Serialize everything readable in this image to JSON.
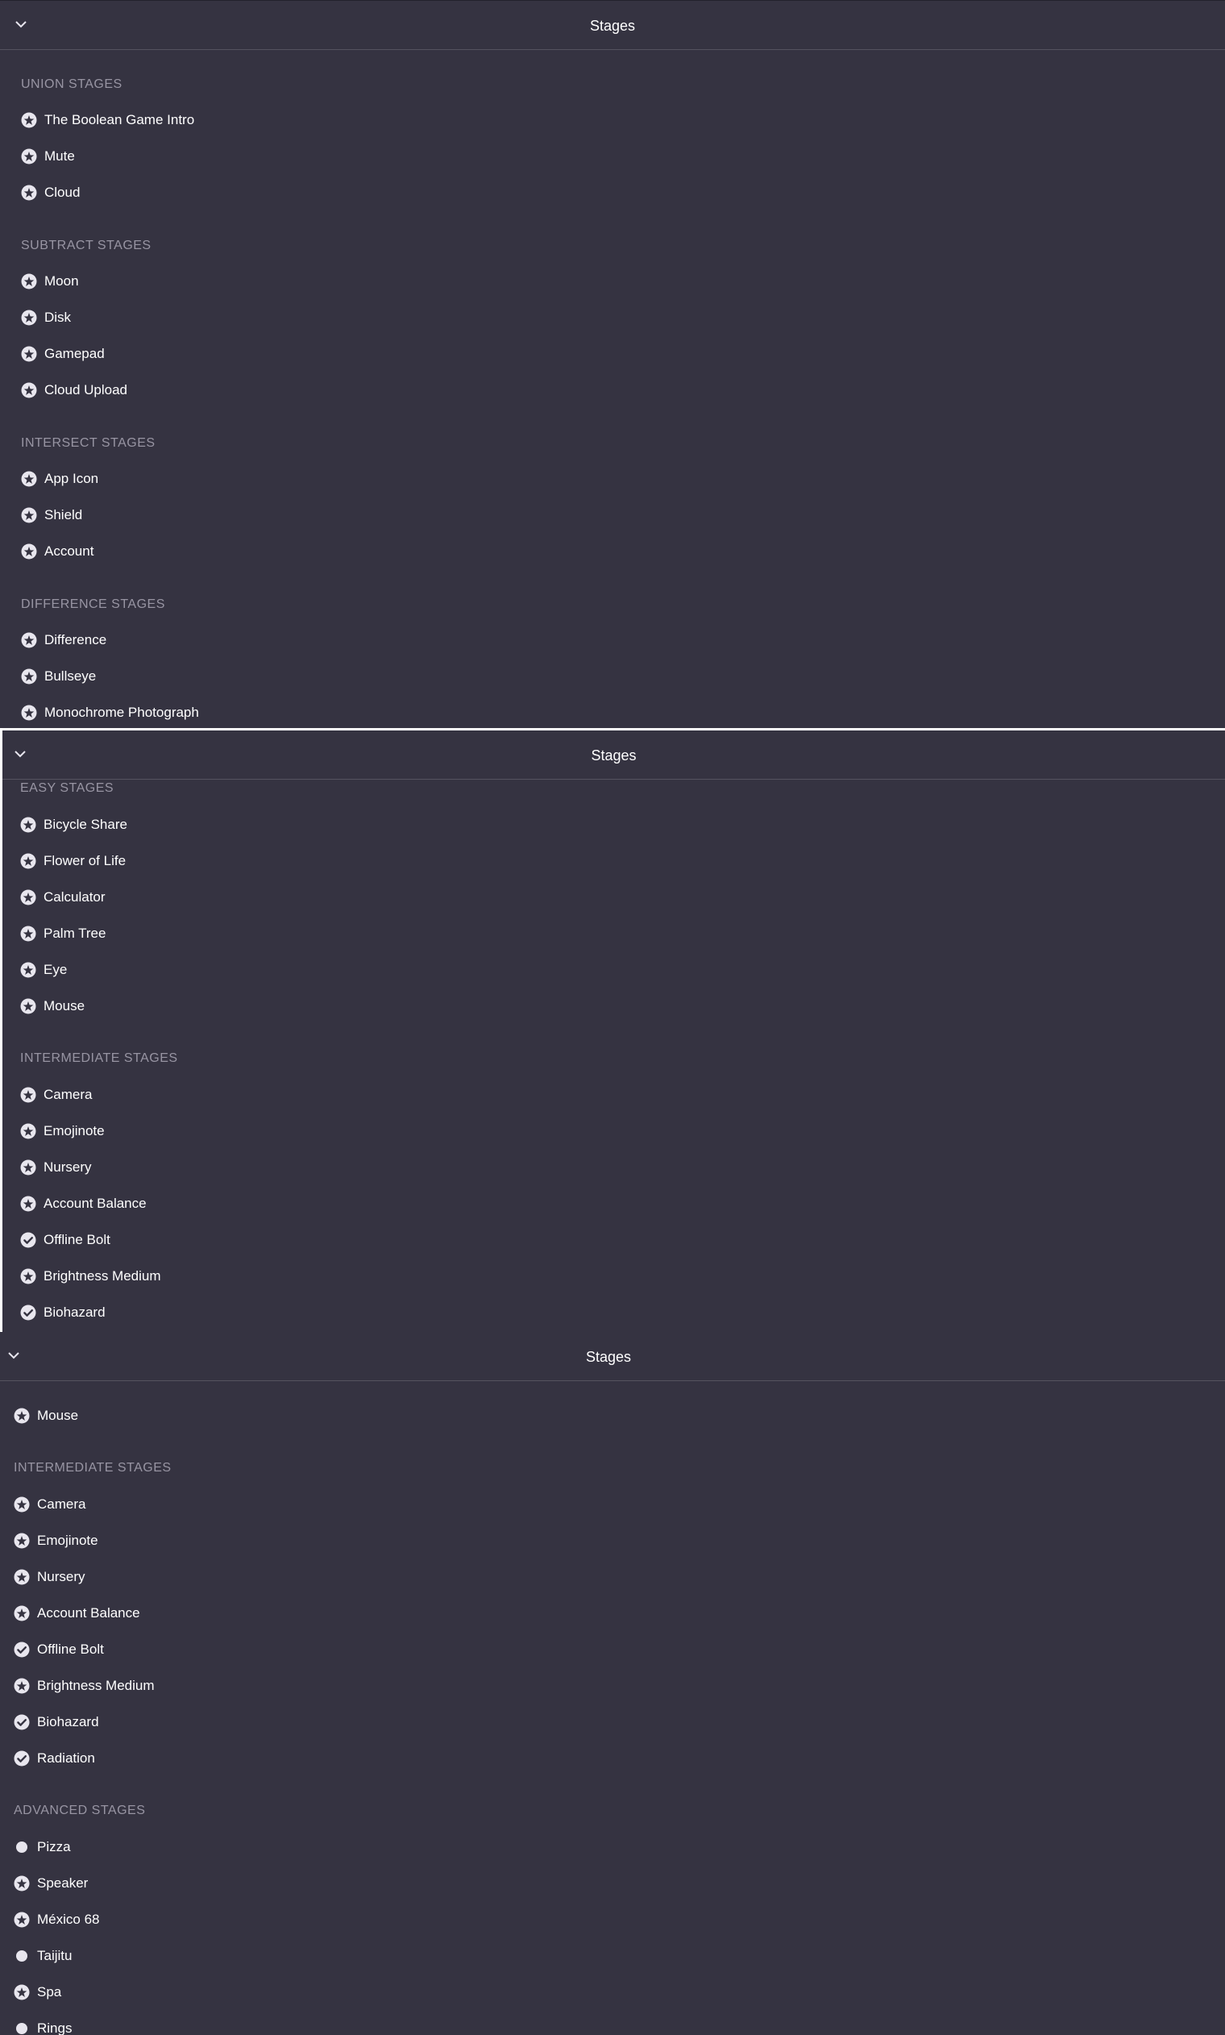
{
  "colors": {
    "panel_bg": "#353341",
    "section_title": "#9895a3",
    "icon_fill": "#e8e6ee",
    "divider": "#55535f"
  },
  "panel1": {
    "header": {
      "title": "Stages",
      "toggle_icon": "chevron-down-icon"
    },
    "sections": [
      {
        "title": "UNION STAGES",
        "items": [
          {
            "label": "The Boolean Game Intro",
            "status": "star"
          },
          {
            "label": "Mute",
            "status": "star"
          },
          {
            "label": "Cloud",
            "status": "star"
          }
        ]
      },
      {
        "title": "SUBTRACT STAGES",
        "items": [
          {
            "label": "Moon",
            "status": "star"
          },
          {
            "label": "Disk",
            "status": "star"
          },
          {
            "label": "Gamepad",
            "status": "star"
          },
          {
            "label": "Cloud Upload",
            "status": "star"
          }
        ]
      },
      {
        "title": "INTERSECT STAGES",
        "items": [
          {
            "label": "App Icon",
            "status": "star"
          },
          {
            "label": "Shield",
            "status": "star"
          },
          {
            "label": "Account",
            "status": "star"
          }
        ]
      },
      {
        "title": "DIFFERENCE STAGES",
        "items": [
          {
            "label": "Difference",
            "status": "star"
          },
          {
            "label": "Bullseye",
            "status": "star"
          },
          {
            "label": "Monochrome Photograph",
            "status": "star"
          }
        ]
      }
    ]
  },
  "panel2": {
    "header": {
      "title": "Stages",
      "toggle_icon": "chevron-down-icon"
    },
    "sections": [
      {
        "title": "EASY STAGES",
        "items": [
          {
            "label": "Bicycle Share",
            "status": "star"
          },
          {
            "label": "Flower of Life",
            "status": "star"
          },
          {
            "label": "Calculator",
            "status": "star"
          },
          {
            "label": "Palm Tree",
            "status": "star"
          },
          {
            "label": "Eye",
            "status": "star"
          },
          {
            "label": "Mouse",
            "status": "star"
          }
        ]
      },
      {
        "title": "INTERMEDIATE STAGES",
        "items": [
          {
            "label": "Camera",
            "status": "star"
          },
          {
            "label": "Emojinote",
            "status": "star"
          },
          {
            "label": "Nursery",
            "status": "star"
          },
          {
            "label": "Account Balance",
            "status": "star"
          },
          {
            "label": "Offline Bolt",
            "status": "check"
          },
          {
            "label": "Brightness Medium",
            "status": "star"
          },
          {
            "label": "Biohazard",
            "status": "check"
          }
        ]
      }
    ]
  },
  "panel3": {
    "header": {
      "title": "Stages",
      "toggle_icon": "chevron-down-icon"
    },
    "sections": [
      {
        "title": "",
        "items": [
          {
            "label": "Mouse",
            "status": "star"
          }
        ]
      },
      {
        "title": "INTERMEDIATE STAGES",
        "items": [
          {
            "label": "Camera",
            "status": "star"
          },
          {
            "label": "Emojinote",
            "status": "star"
          },
          {
            "label": "Nursery",
            "status": "star"
          },
          {
            "label": "Account Balance",
            "status": "star"
          },
          {
            "label": "Offline Bolt",
            "status": "check"
          },
          {
            "label": "Brightness Medium",
            "status": "star"
          },
          {
            "label": "Biohazard",
            "status": "check"
          },
          {
            "label": "Radiation",
            "status": "check"
          }
        ]
      },
      {
        "title": "ADVANCED STAGES",
        "items": [
          {
            "label": "Pizza",
            "status": "dot"
          },
          {
            "label": "Speaker",
            "status": "star"
          },
          {
            "label": "México 68",
            "status": "star"
          },
          {
            "label": "Taijitu",
            "status": "dot"
          },
          {
            "label": "Spa",
            "status": "star"
          },
          {
            "label": "Rings",
            "status": "dot"
          }
        ]
      }
    ]
  }
}
